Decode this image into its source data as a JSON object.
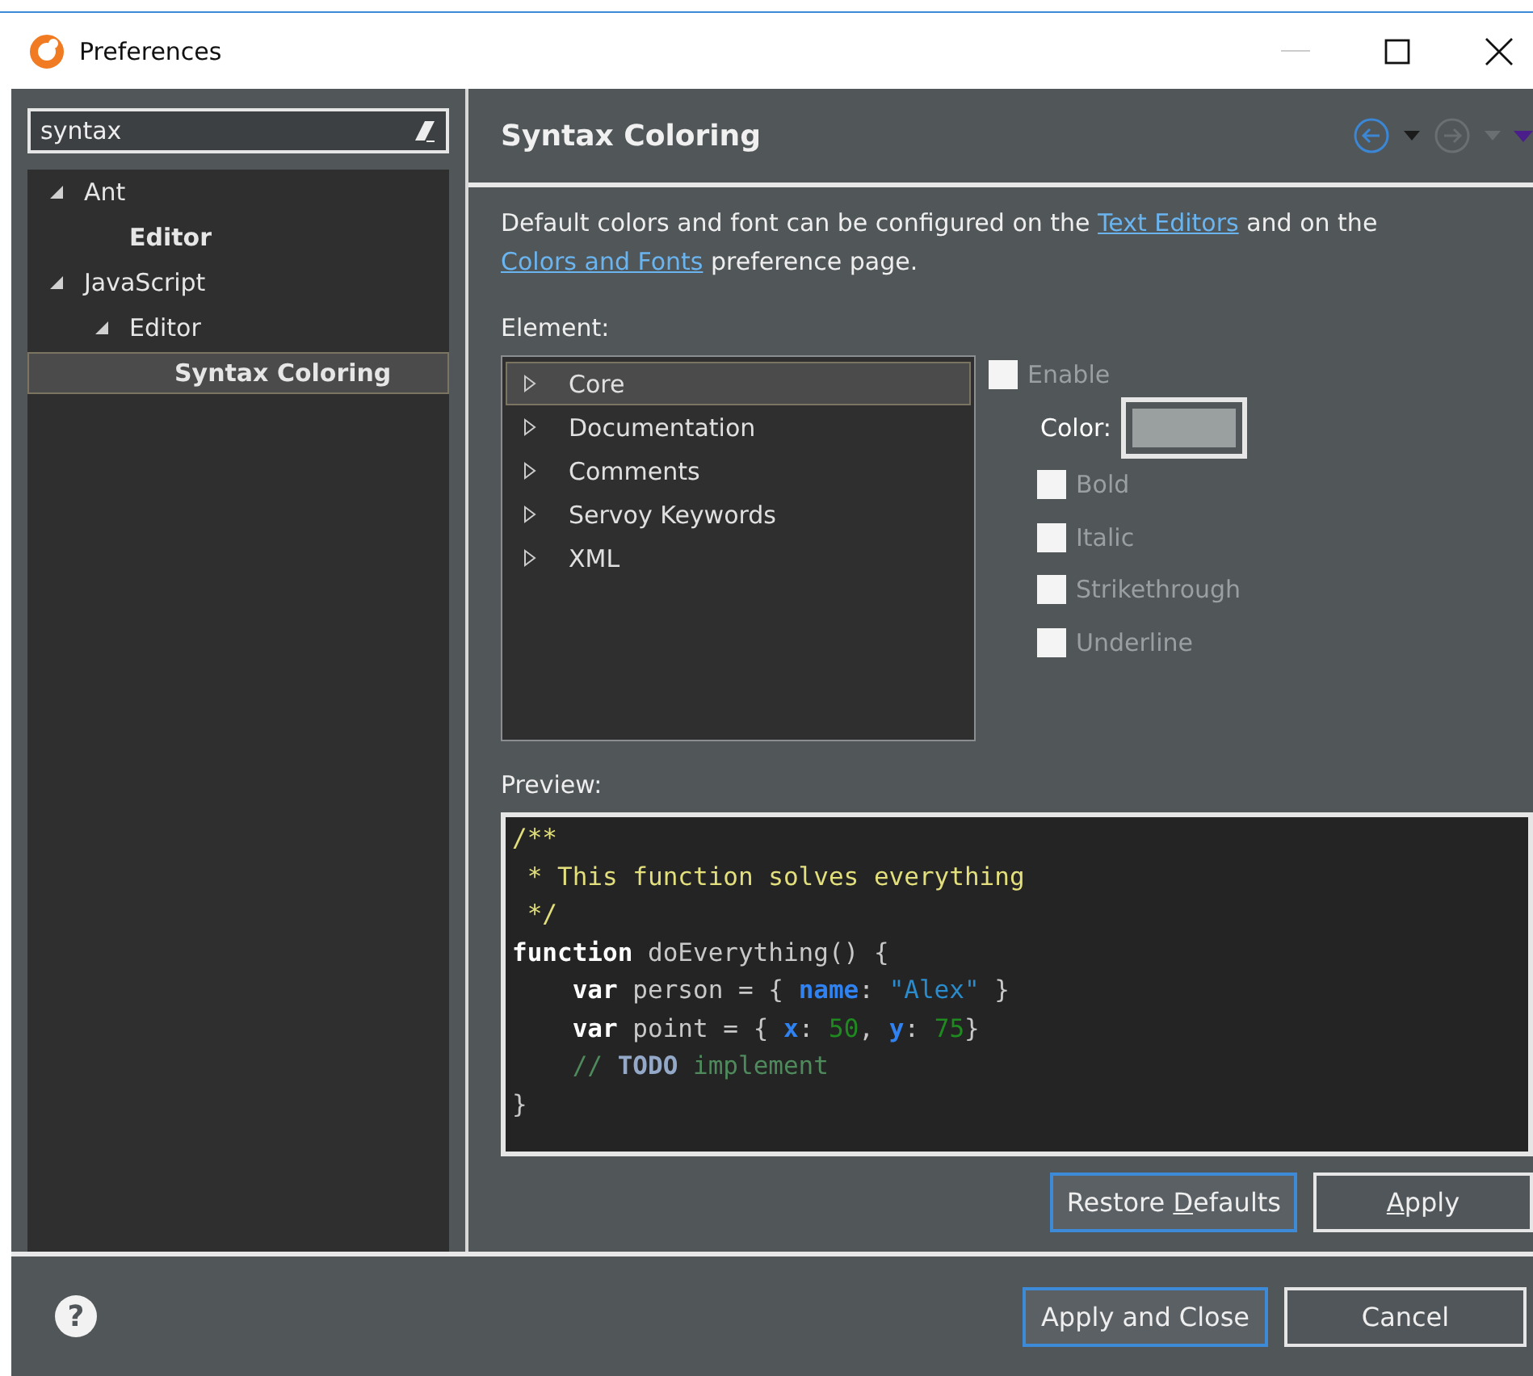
{
  "window": {
    "title": "Preferences"
  },
  "filter": {
    "value": "syntax"
  },
  "tree": [
    {
      "label": "Ant",
      "match": false,
      "expanded": true,
      "selected": false,
      "children": [
        {
          "label": "Editor",
          "match": true,
          "selected": false
        }
      ]
    },
    {
      "label": "JavaScript",
      "match": false,
      "expanded": true,
      "selected": false,
      "children": [
        {
          "label": "Editor",
          "match": false,
          "expanded": true,
          "selected": false,
          "children": [
            {
              "label": "Syntax Coloring",
              "match": true,
              "selected": true
            }
          ]
        }
      ]
    }
  ],
  "page": {
    "title": "Syntax Coloring",
    "nav": [
      {
        "kind": "back",
        "disabled": false
      },
      {
        "kind": "dropdown",
        "disabled": false
      },
      {
        "kind": "forward",
        "disabled": true
      },
      {
        "kind": "dropdown",
        "disabled": true
      },
      {
        "kind": "menu",
        "disabled": false
      }
    ],
    "description": [
      {
        "text": "Default colors and font can be configured on the ",
        "link": false
      },
      {
        "text": "Text Editors",
        "link": true
      },
      {
        "text": " and on the ",
        "link": false
      },
      {
        "text": "Colors and Fonts",
        "link": true
      },
      {
        "text": " preference page.",
        "link": false
      }
    ],
    "element_label": "Element:",
    "elements": [
      {
        "label": "Core",
        "selected": true,
        "expanded": false
      },
      {
        "label": "Documentation",
        "selected": false,
        "expanded": false
      },
      {
        "label": "Comments",
        "selected": false,
        "expanded": false
      },
      {
        "label": "Servoy Keywords",
        "selected": false,
        "expanded": false
      },
      {
        "label": "XML",
        "selected": false,
        "expanded": false
      }
    ],
    "enable": {
      "label": "Enable",
      "checked": false,
      "disabled": true
    },
    "color": {
      "label": "Color:",
      "disabled": true
    },
    "styles": [
      {
        "label": "Bold",
        "checked": false,
        "disabled": true
      },
      {
        "label": "Italic",
        "checked": false,
        "disabled": true
      },
      {
        "label": "Strikethrough",
        "checked": false,
        "disabled": true
      },
      {
        "label": "Underline",
        "checked": false,
        "disabled": true
      }
    ],
    "preview_label": "Preview:",
    "preview": [
      [
        {
          "text": "/**",
          "kind": "doc"
        }
      ],
      [
        {
          "text": " * This function solves everything",
          "kind": "doc"
        }
      ],
      [
        {
          "text": " */",
          "kind": "doc"
        }
      ],
      [
        {
          "text": "function",
          "kind": "keyword"
        },
        {
          "text": " doEverything() {",
          "kind": "plain"
        }
      ],
      [
        {
          "text": "    var",
          "kind": "keyword"
        },
        {
          "text": " person = { ",
          "kind": "plain"
        },
        {
          "text": "name",
          "kind": "field"
        },
        {
          "text": ": ",
          "kind": "plain"
        },
        {
          "text": "\"Alex\"",
          "kind": "string"
        },
        {
          "text": " }",
          "kind": "plain"
        }
      ],
      [
        {
          "text": "    var",
          "kind": "keyword"
        },
        {
          "text": " point = { ",
          "kind": "plain"
        },
        {
          "text": "x",
          "kind": "field"
        },
        {
          "text": ": ",
          "kind": "plain"
        },
        {
          "text": "50",
          "kind": "number"
        },
        {
          "text": ", ",
          "kind": "plain"
        },
        {
          "text": "y",
          "kind": "field"
        },
        {
          "text": ": ",
          "kind": "plain"
        },
        {
          "text": "75",
          "kind": "number"
        },
        {
          "text": "}",
          "kind": "plain"
        }
      ],
      [
        {
          "text": "    // ",
          "kind": "comment"
        },
        {
          "text": "TODO",
          "kind": "todo"
        },
        {
          "text": " implement",
          "kind": "comment"
        }
      ],
      [
        {
          "text": "}",
          "kind": "plain"
        }
      ]
    ],
    "buttons": [
      {
        "parts": [
          {
            "text": "Restore ",
            "mnemonic": false
          },
          {
            "text": "D",
            "mnemonic": true
          },
          {
            "text": "efaults",
            "mnemonic": false
          }
        ],
        "focused": true
      },
      {
        "parts": [
          {
            "text": "A",
            "mnemonic": true
          },
          {
            "text": "pply",
            "mnemonic": false
          }
        ],
        "focused": false
      }
    ]
  },
  "footer": {
    "help": "?",
    "buttons": [
      {
        "label": "Apply and Close",
        "focused": true
      },
      {
        "label": "Cancel",
        "focused": false
      }
    ]
  }
}
